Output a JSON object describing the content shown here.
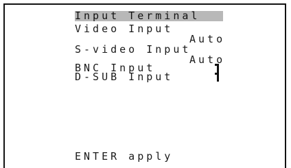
{
  "menu": {
    "title": "Input Terminal",
    "items": [
      {
        "label": "Video Input",
        "value": "Auto"
      },
      {
        "label": "S-video Input",
        "value": "Auto"
      },
      {
        "label": "BNC Input",
        "value": ""
      },
      {
        "label": "D-SUB Input",
        "value": ""
      }
    ],
    "footer_hint": "ENTER apply"
  },
  "colors": {
    "title_highlight": "#b8b8b8",
    "background": "#ffffff",
    "text": "#1a1a1a"
  },
  "icons": {
    "selected_marker": "bracket-mark-icon"
  }
}
